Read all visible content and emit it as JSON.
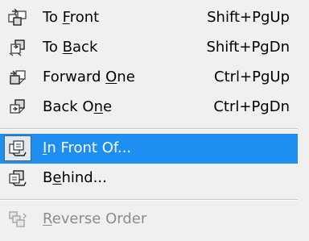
{
  "menu": {
    "items": [
      {
        "pre": "To ",
        "accel": "F",
        "post": "ront",
        "shortcut": "Shift+PgUp",
        "icon": "to-front-icon"
      },
      {
        "pre": "To ",
        "accel": "B",
        "post": "ack",
        "shortcut": "Shift+PgDn",
        "icon": "to-back-icon"
      },
      {
        "pre": "Forward ",
        "accel": "O",
        "post": "ne",
        "shortcut": "Ctrl+PgUp",
        "icon": "forward-one-icon"
      },
      {
        "pre": "Back O",
        "accel": "n",
        "post": "e",
        "shortcut": "Ctrl+PgDn",
        "icon": "back-one-icon"
      },
      {
        "pre": "",
        "accel": "I",
        "post": "n Front Of...",
        "shortcut": "",
        "icon": "in-front-of-icon",
        "state": "selected"
      },
      {
        "pre": "B",
        "accel": "e",
        "post": "hind...",
        "shortcut": "",
        "icon": "behind-icon"
      },
      {
        "pre": "",
        "accel": "R",
        "post": "everse Order",
        "shortcut": "",
        "icon": "reverse-order-icon",
        "state": "disabled"
      }
    ]
  },
  "colors": {
    "highlight": "#1e8ff0",
    "highlight_text": "#ffffff",
    "disabled_text": "#8c8c8c",
    "menu_background": "#f0f0f0"
  }
}
